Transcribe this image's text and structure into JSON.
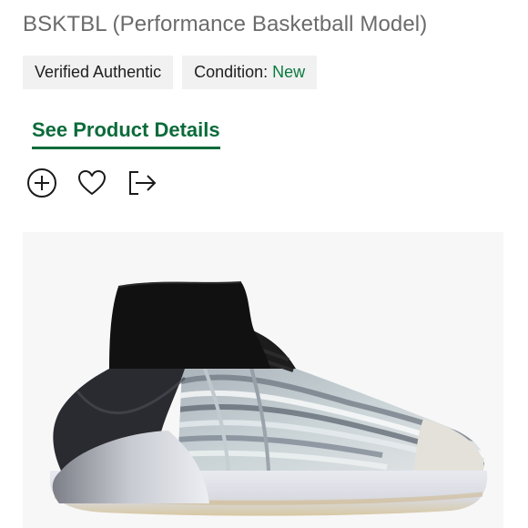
{
  "product": {
    "subtitle": "BSKTBL (Performance Basketball Model)"
  },
  "badges": {
    "verified_label": "Verified Authentic",
    "condition_label": "Condition:",
    "condition_value": "New"
  },
  "links": {
    "see_details": "See Product Details"
  },
  "actions": {
    "icons": [
      "plus-circle-icon",
      "heart-icon",
      "share-icon"
    ]
  },
  "colors": {
    "accent_green": "#0b6b3a",
    "condition_green": "#0a7a3f",
    "badge_bg": "#f1f1f1",
    "subtitle_gray": "#6b6b6b"
  },
  "image": {
    "subject": "basketball-sneaker-image"
  }
}
